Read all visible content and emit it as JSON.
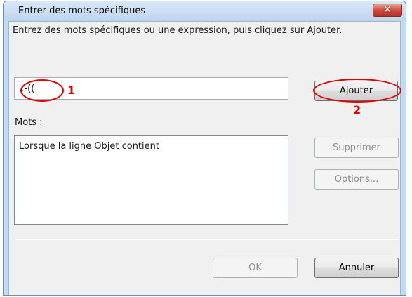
{
  "dialog": {
    "title": "Entrer des mots spécifiques",
    "close_glyph": "✕",
    "instruction": "Entrez des mots spécifiques ou une expression, puis cliquez sur Ajouter.",
    "input_value": ":-((",
    "add_label": "Ajouter",
    "words_label": "Mots :",
    "words": [
      "Lorsque la ligne Objet contient"
    ],
    "remove_label": "Supprimer",
    "options_label": "Options...",
    "ok_label": "OK",
    "cancel_label": "Annuler"
  },
  "annotations": {
    "marker_1": "1",
    "marker_2": "2",
    "color": "#e10000"
  },
  "icons": {
    "close": "close-icon"
  }
}
